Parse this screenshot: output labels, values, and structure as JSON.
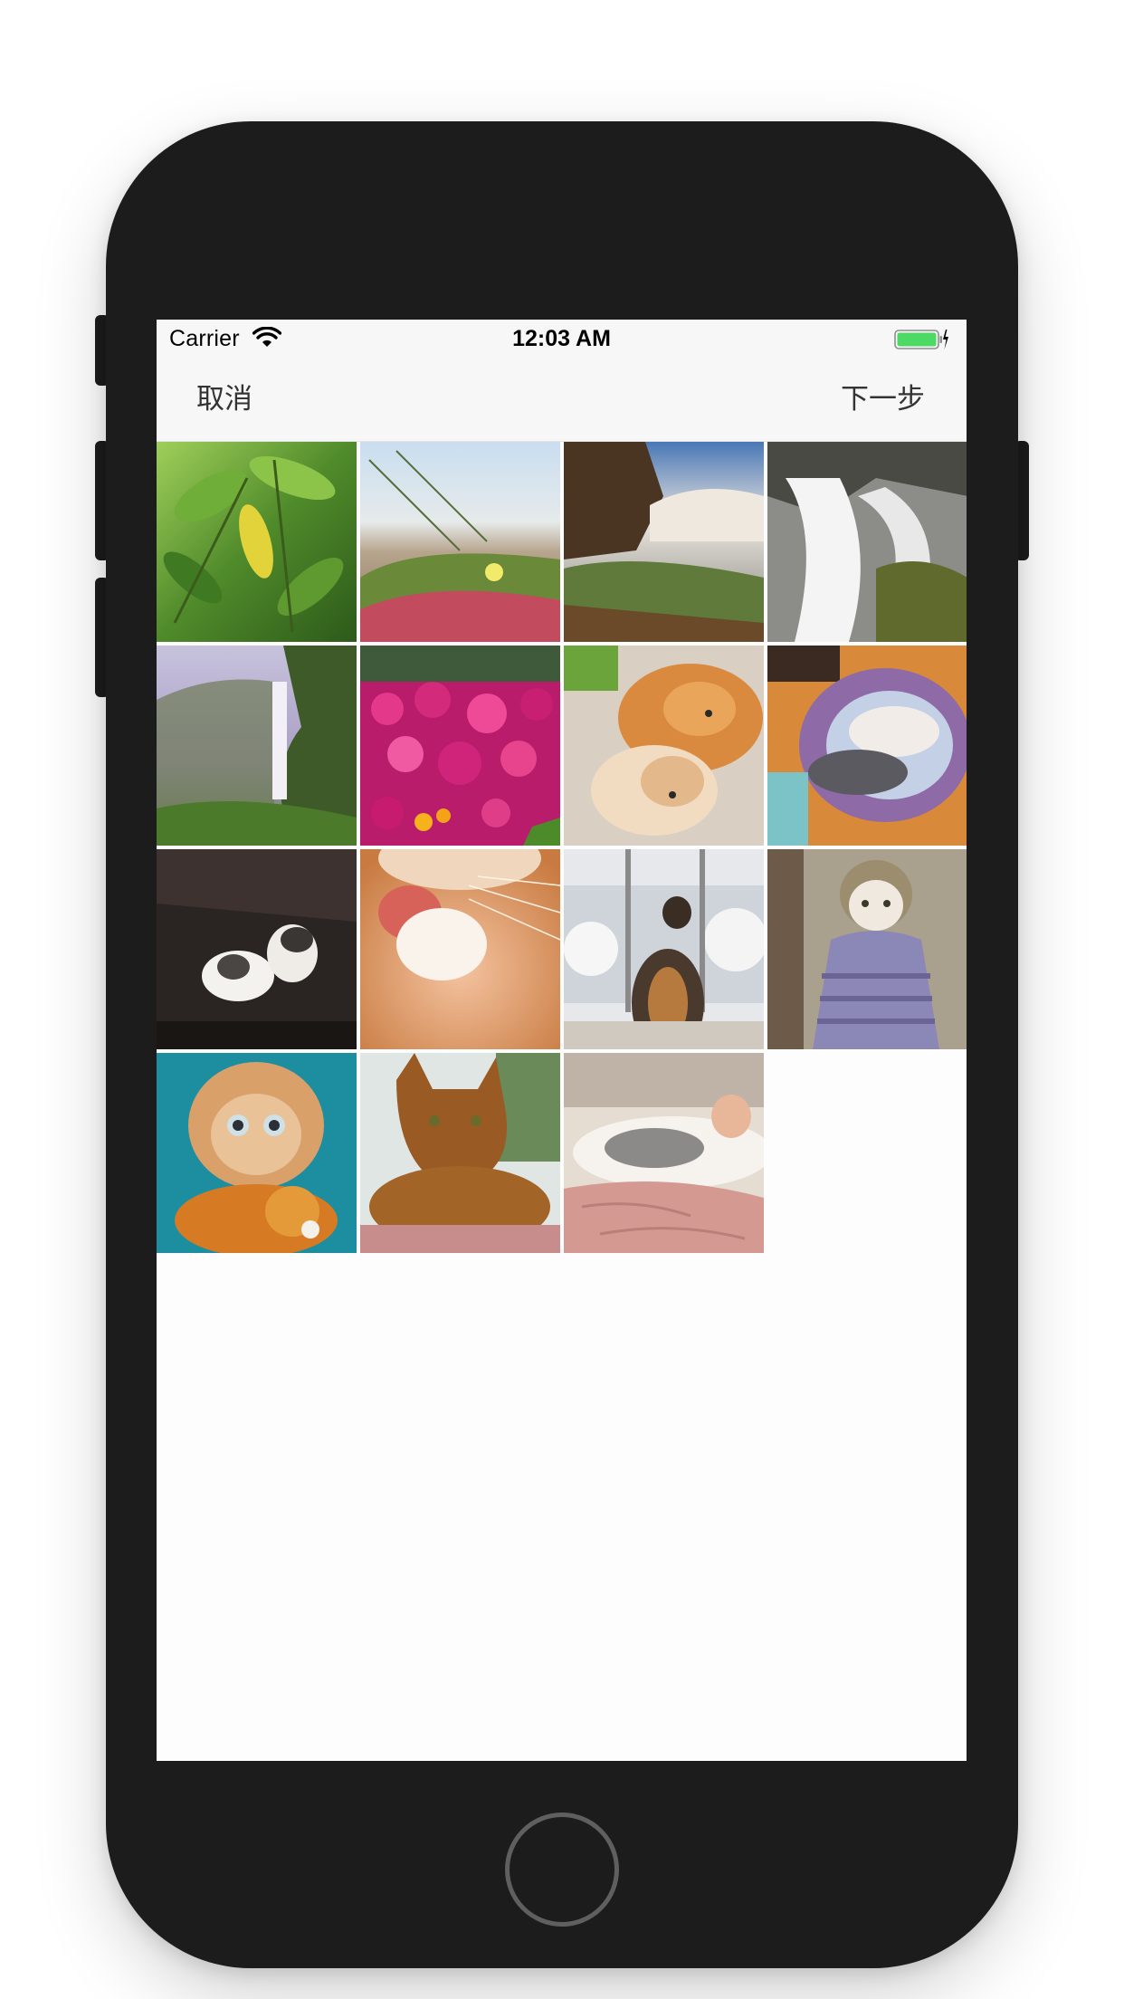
{
  "status_bar": {
    "carrier": "Carrier",
    "time": "12:03 AM",
    "wifi_icon": "wifi-icon",
    "battery_icon": "battery-charging-icon",
    "battery_color": "#4cd964"
  },
  "nav_bar": {
    "cancel_label": "取消",
    "next_label": "下一步"
  },
  "photos": [
    {
      "name": "photo-green-leaves",
      "subject": "green leaves"
    },
    {
      "name": "photo-beach-flower",
      "subject": "beach flower"
    },
    {
      "name": "photo-waterfall-cliff",
      "subject": "waterfall cliff"
    },
    {
      "name": "photo-waterfall-rocks",
      "subject": "waterfall rocks"
    },
    {
      "name": "photo-misty-waterfall",
      "subject": "misty waterfall"
    },
    {
      "name": "photo-pink-flowers",
      "subject": "pink flowers"
    },
    {
      "name": "photo-kittens-cuddling",
      "subject": "kittens cuddling"
    },
    {
      "name": "photo-cats-in-bed",
      "subject": "cats in bed"
    },
    {
      "name": "photo-kitten-dark",
      "subject": "kitten on dark background"
    },
    {
      "name": "photo-cat-paw-closeup",
      "subject": "cat paw closeup"
    },
    {
      "name": "photo-cat-window-snow",
      "subject": "cat at snowy window"
    },
    {
      "name": "photo-cat-in-sweater",
      "subject": "cat in sweater"
    },
    {
      "name": "photo-kitten-with-toy",
      "subject": "kitten with toy"
    },
    {
      "name": "photo-abyssinian-cat",
      "subject": "abyssinian cat"
    },
    {
      "name": "photo-sleeping-cat",
      "subject": "sleeping cat"
    }
  ]
}
